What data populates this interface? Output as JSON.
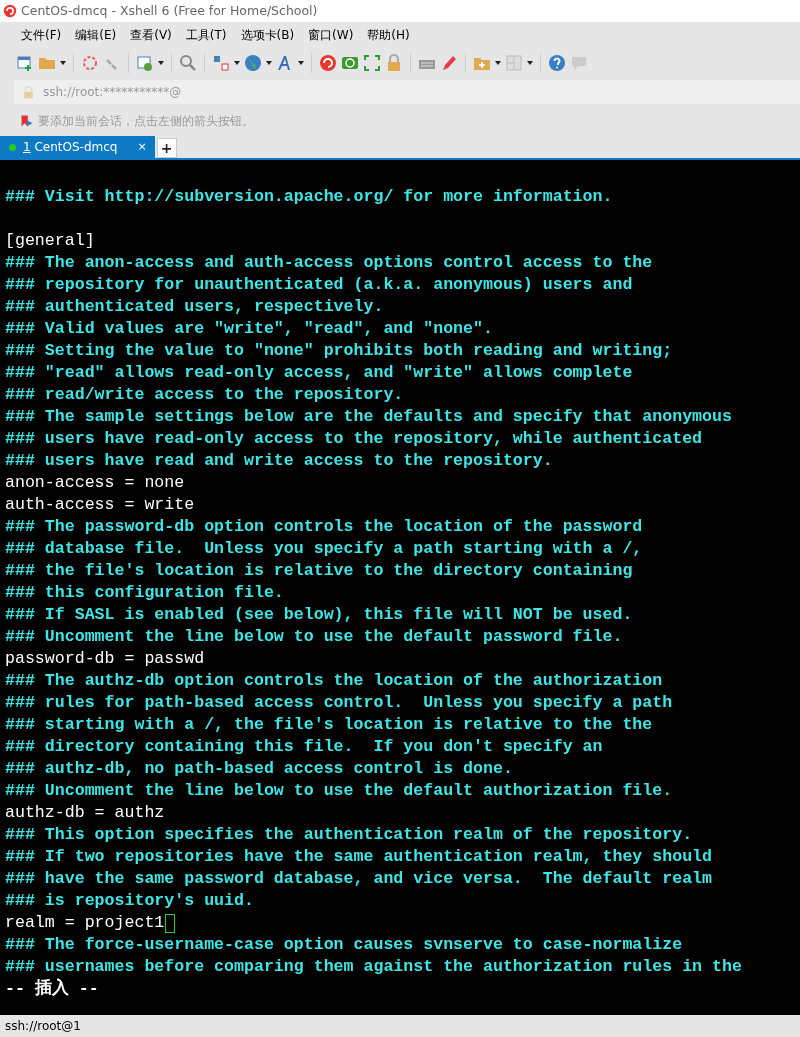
{
  "window": {
    "title": "CentOS-dmcq - Xshell 6 (Free for Home/School)"
  },
  "menu": [
    "文件(F)",
    "编辑(E)",
    "查看(V)",
    "工具(T)",
    "选项卡(B)",
    "窗口(W)",
    "帮助(H)"
  ],
  "address_bar": {
    "value": "ssh://root:***********@"
  },
  "hint": "要添加当前会话，点击左侧的箭头按钮。",
  "tabs": [
    {
      "number": "1",
      "label": "CentOS-dmcq",
      "selected": true,
      "connected": true,
      "close": "×"
    }
  ],
  "new_tab": "+",
  "terminal": {
    "lines": [
      {
        "kind": "blank"
      },
      {
        "kind": "comment",
        "text": "### Visit http://subversion.apache.org/ for more information."
      },
      {
        "kind": "blank"
      },
      {
        "kind": "setting",
        "text": "[general]"
      },
      {
        "kind": "comment",
        "text": "### The anon-access and auth-access options control access to the"
      },
      {
        "kind": "comment",
        "text": "### repository for unauthenticated (a.k.a. anonymous) users and"
      },
      {
        "kind": "comment",
        "text": "### authenticated users, respectively."
      },
      {
        "kind": "comment",
        "text": "### Valid values are \"write\", \"read\", and \"none\"."
      },
      {
        "kind": "comment",
        "text": "### Setting the value to \"none\" prohibits both reading and writing;"
      },
      {
        "kind": "comment",
        "text": "### \"read\" allows read-only access, and \"write\" allows complete"
      },
      {
        "kind": "comment",
        "text": "### read/write access to the repository."
      },
      {
        "kind": "comment",
        "text": "### The sample settings below are the defaults and specify that anonymous"
      },
      {
        "kind": "comment",
        "text": "### users have read-only access to the repository, while authenticated"
      },
      {
        "kind": "comment",
        "text": "### users have read and write access to the repository."
      },
      {
        "kind": "setting",
        "text": "anon-access = none"
      },
      {
        "kind": "setting",
        "text": "auth-access = write"
      },
      {
        "kind": "comment",
        "text": "### The password-db option controls the location of the password"
      },
      {
        "kind": "comment",
        "text": "### database file.  Unless you specify a path starting with a /,"
      },
      {
        "kind": "comment",
        "text": "### the file's location is relative to the directory containing"
      },
      {
        "kind": "comment",
        "text": "### this configuration file."
      },
      {
        "kind": "comment",
        "text": "### If SASL is enabled (see below), this file will NOT be used."
      },
      {
        "kind": "comment",
        "text": "### Uncomment the line below to use the default password file."
      },
      {
        "kind": "setting",
        "text": "password-db = passwd"
      },
      {
        "kind": "comment",
        "text": "### The authz-db option controls the location of the authorization"
      },
      {
        "kind": "comment",
        "text": "### rules for path-based access control.  Unless you specify a path"
      },
      {
        "kind": "comment",
        "text": "### starting with a /, the file's location is relative to the the"
      },
      {
        "kind": "comment",
        "text": "### directory containing this file.  If you don't specify an"
      },
      {
        "kind": "comment",
        "text": "### authz-db, no path-based access control is done."
      },
      {
        "kind": "comment",
        "text": "### Uncomment the line below to use the default authorization file."
      },
      {
        "kind": "setting",
        "text": "authz-db = authz"
      },
      {
        "kind": "comment",
        "text": "### This option specifies the authentication realm of the repository."
      },
      {
        "kind": "comment",
        "text": "### If two repositories have the same authentication realm, they should"
      },
      {
        "kind": "comment",
        "text": "### have the same password database, and vice versa.  The default realm"
      },
      {
        "kind": "comment",
        "text": "### is repository's uuid."
      },
      {
        "kind": "setting",
        "text": "realm = project1",
        "cursor": true
      },
      {
        "kind": "comment",
        "text": "### The force-username-case option causes svnserve to case-normalize"
      },
      {
        "kind": "comment",
        "text": "### usernames before comparing them against the authorization rules in the"
      },
      {
        "kind": "mode",
        "text": "-- 插入 --"
      }
    ]
  },
  "status_bar": {
    "text": "ssh://root@1"
  }
}
